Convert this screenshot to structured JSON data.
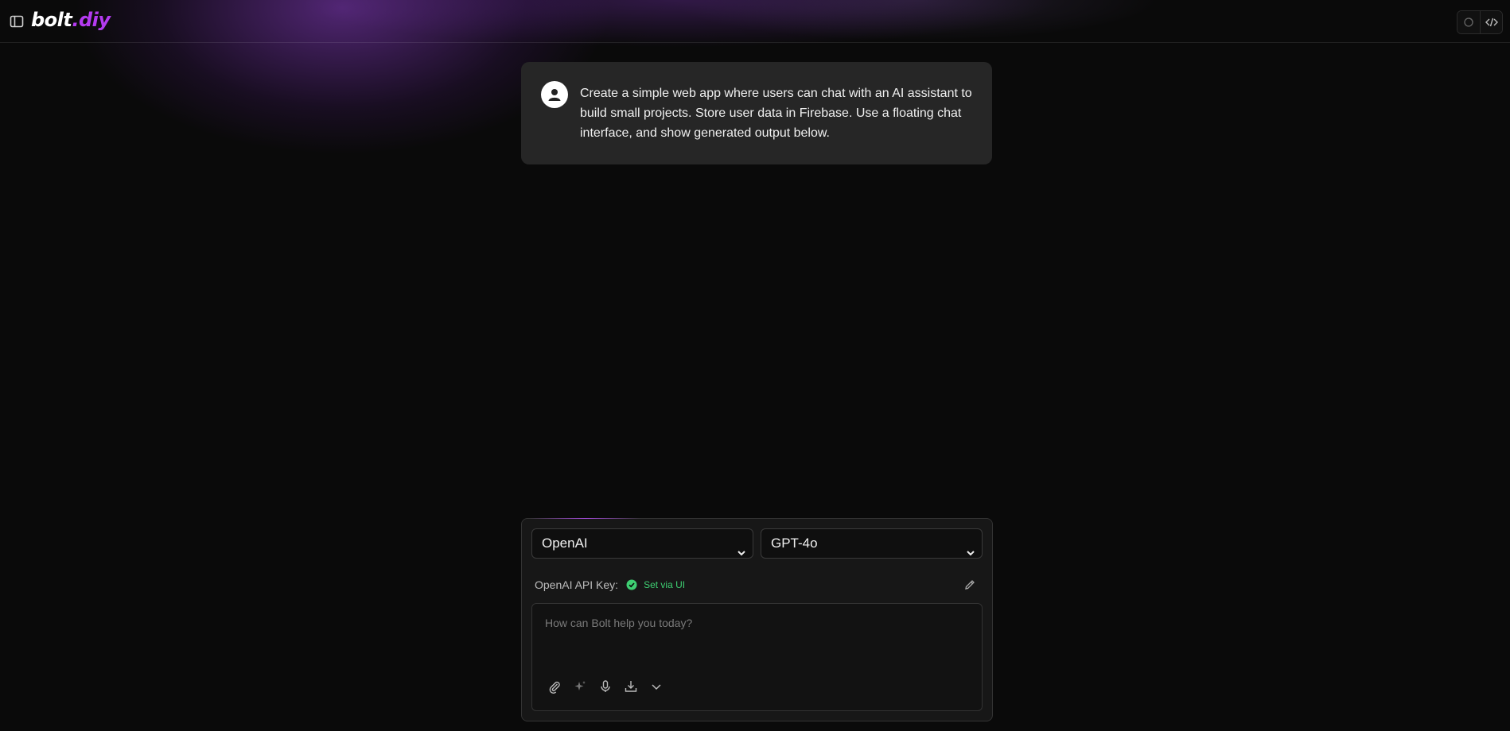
{
  "header": {
    "logo_part1": "bolt",
    "logo_part2": ".diy"
  },
  "user_message": {
    "text": "Create a simple web app where users can chat with an AI assistant to build small projects. Store user data in Firebase. Use a floating chat interface, and show generated output below."
  },
  "chat_input": {
    "provider_selected": "OpenAI",
    "model_selected": "GPT-4o",
    "api_key_label": "OpenAI API Key:",
    "api_key_status": "Set via UI",
    "placeholder": "How can Bolt help you today?"
  },
  "colors": {
    "accent": "#b43bf0",
    "status_ok": "#3ecf72",
    "background": "#0a0a0a"
  },
  "icons": [
    "sidebar-toggle-icon",
    "cloud-icon",
    "code-icon",
    "user-icon",
    "check-circle-icon",
    "pencil-icon",
    "paperclip-icon",
    "sparkles-icon",
    "microphone-icon",
    "download-icon",
    "chevron-down-icon"
  ]
}
